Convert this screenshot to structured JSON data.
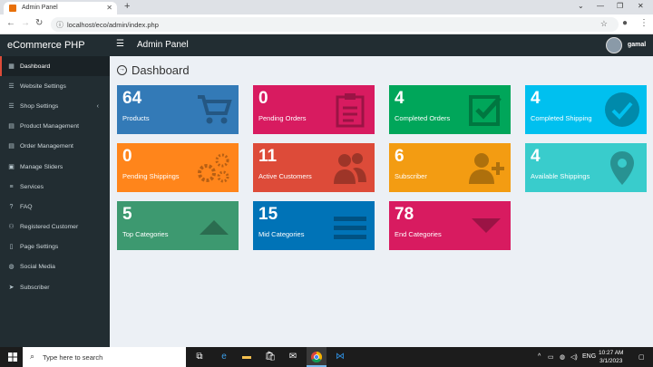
{
  "browser": {
    "tab_title": "Admin Panel",
    "url": "localhost/eco/admin/index.php"
  },
  "header": {
    "brand": "eCommerce PHP",
    "title": "Admin Panel",
    "user": "gamal"
  },
  "sidebar": {
    "items": [
      {
        "label": "Dashboard"
      },
      {
        "label": "Website Settings"
      },
      {
        "label": "Shop Settings"
      },
      {
        "label": "Product Management"
      },
      {
        "label": "Order Management"
      },
      {
        "label": "Manage Sliders"
      },
      {
        "label": "Services"
      },
      {
        "label": "FAQ"
      },
      {
        "label": "Registered Customer"
      },
      {
        "label": "Page Settings"
      },
      {
        "label": "Social Media"
      },
      {
        "label": "Subscriber"
      }
    ]
  },
  "main": {
    "page_title": "Dashboard",
    "cards": [
      {
        "value": "64",
        "label": "Products",
        "color": "#337ab7"
      },
      {
        "value": "0",
        "label": "Pending Orders",
        "color": "#d81b60"
      },
      {
        "value": "4",
        "label": "Completed Orders",
        "color": "#00a65a"
      },
      {
        "value": "4",
        "label": "Completed Shipping",
        "color": "#00c0ef"
      },
      {
        "value": "0",
        "label": "Pending Shippings",
        "color": "#ff851b"
      },
      {
        "value": "11",
        "label": "Active Customers",
        "color": "#dd4b39"
      },
      {
        "value": "6",
        "label": "Subscriber",
        "color": "#f39c12"
      },
      {
        "value": "4",
        "label": "Available Shippings",
        "color": "#39cccc"
      },
      {
        "value": "5",
        "label": "Top Categories",
        "color": "#3d9970"
      },
      {
        "value": "15",
        "label": "Mid Categories",
        "color": "#0073b7"
      },
      {
        "value": "78",
        "label": "End Categories",
        "color": "#d81b60"
      }
    ]
  },
  "taskbar": {
    "search_placeholder": "Type here to search",
    "lang": "ENG",
    "time": "10:27 AM",
    "date": "3/1/2023"
  }
}
